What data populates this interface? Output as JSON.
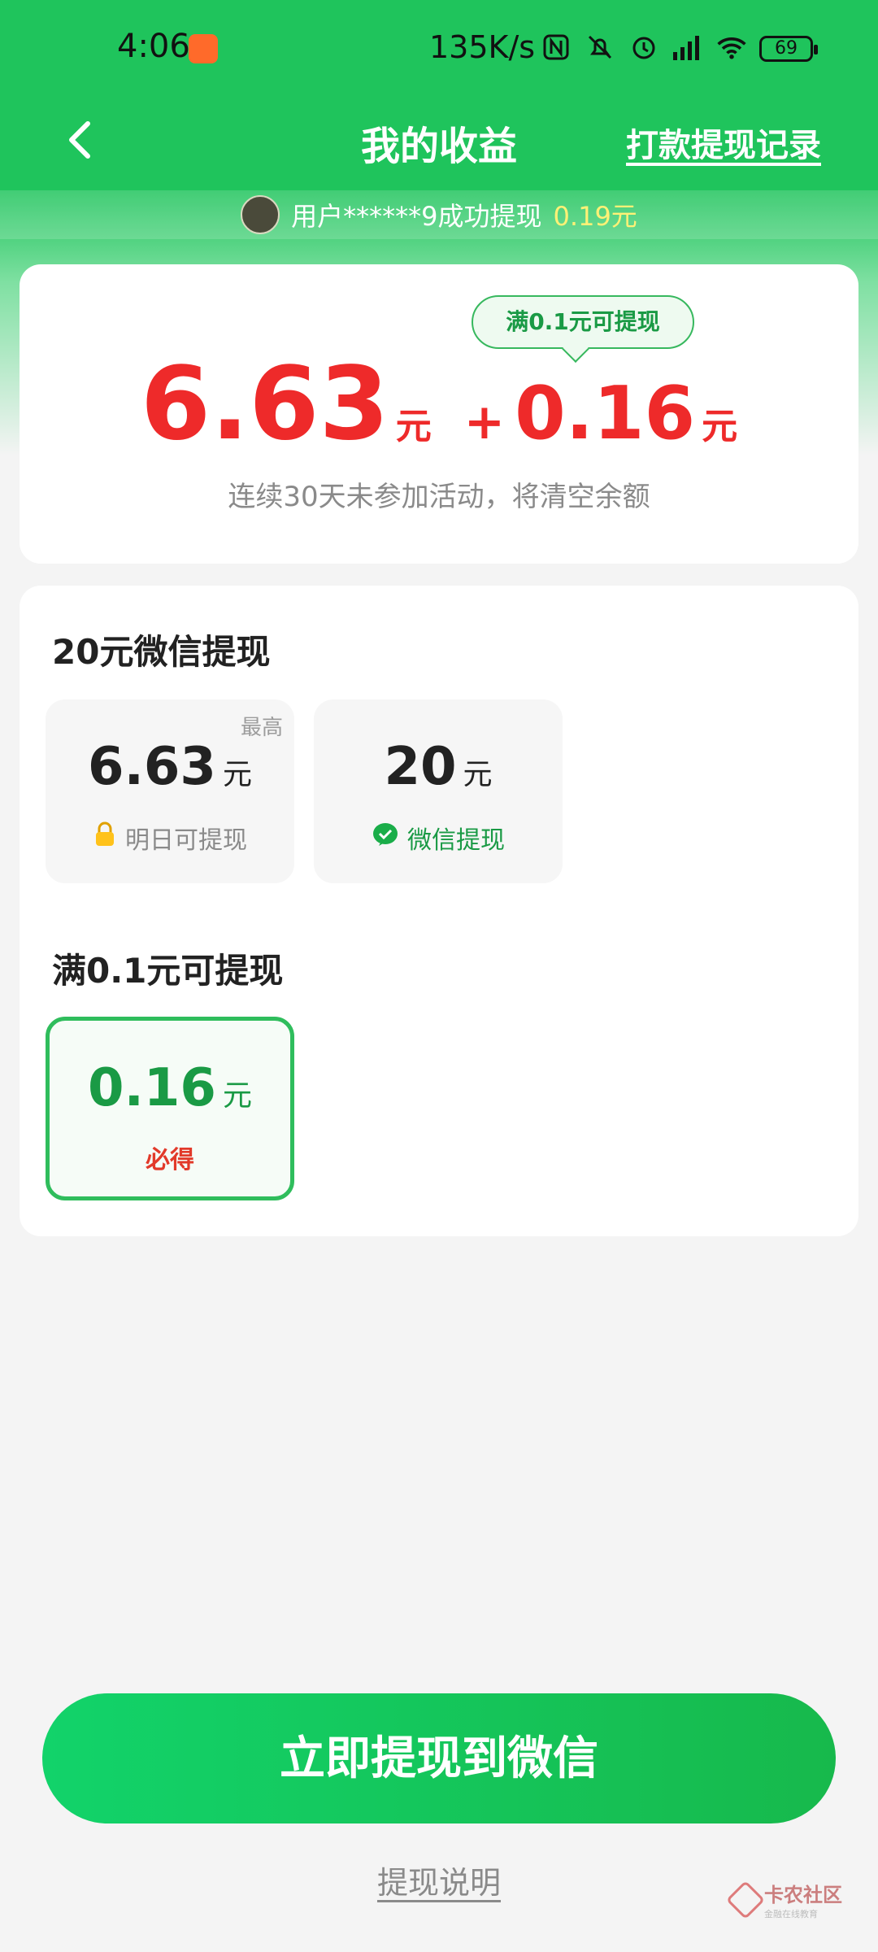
{
  "status_bar": {
    "time": "4:06",
    "network_speed": "135K/s",
    "battery": "69",
    "icons": [
      "nfc-icon",
      "bell-off-icon",
      "alarm-icon",
      "signal-icon",
      "wifi-icon"
    ]
  },
  "header": {
    "title": "我的收益",
    "records_link": "打款提现记录"
  },
  "ticker": {
    "message": "用户******9成功提现",
    "amount": "0.19元"
  },
  "balance": {
    "tooltip": "满0.1元可提现",
    "main_amount": "6.63",
    "main_unit": "元",
    "plus": "+",
    "bonus_amount": "0.16",
    "bonus_unit": "元",
    "note": "连续30天未参加活动，将清空余额"
  },
  "wechat_section": {
    "title": "20元微信提现",
    "options": [
      {
        "corner": "最高",
        "amount": "6.63",
        "unit": "元",
        "sub": "明日可提现",
        "icon": "lock-icon"
      },
      {
        "amount": "20",
        "unit": "元",
        "sub": "微信提现",
        "icon": "wechat-icon"
      }
    ]
  },
  "min_section": {
    "title": "满0.1元可提现",
    "option": {
      "amount": "0.16",
      "unit": "元",
      "badge": "必得",
      "selected": true
    }
  },
  "cta": {
    "label": "立即提现到微信"
  },
  "explain_link": "提现说明",
  "watermark": {
    "main": "卡农社区",
    "sub": "金融在线教育"
  },
  "colors": {
    "brand_green": "#1fc45c",
    "amount_red": "#ee2a2a",
    "accent_green": "#1a9a45"
  }
}
